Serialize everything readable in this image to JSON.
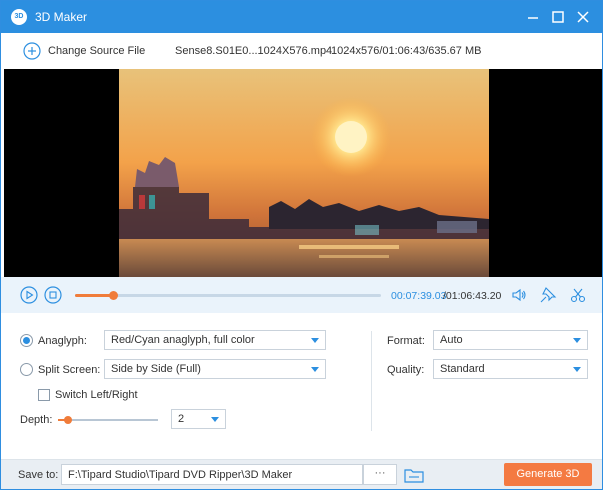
{
  "window": {
    "title": "3D Maker",
    "icon_text": "3D"
  },
  "toolbar": {
    "change_source_label": "Change Source File",
    "file_name": "Sense8.S01E0...1024X576.mp4",
    "file_info": "1024x576/01:06:43/635.67 MB"
  },
  "playback": {
    "current_time": "00:07:39.03",
    "total_time": "/01:06:43.20",
    "progress_fraction": 0.125
  },
  "settings": {
    "anaglyph_label": "Anaglyph:",
    "anaglyph_value": "Red/Cyan anaglyph, full color",
    "anaglyph_selected": true,
    "split_label": "Split Screen:",
    "split_value": "Side by Side (Full)",
    "split_selected": false,
    "switch_label": "Switch Left/Right",
    "switch_checked": false,
    "depth_label": "Depth:",
    "depth_value": "2",
    "depth_fraction": 0.1,
    "format_label": "Format:",
    "format_value": "Auto",
    "quality_label": "Quality:",
    "quality_value": "Standard"
  },
  "bottom": {
    "save_to_label": "Save to:",
    "save_path": "F:\\Tipard Studio\\Tipard DVD Ripper\\3D Maker",
    "browse_label": "···",
    "generate_label": "Generate 3D"
  },
  "colors": {
    "accent": "#2c8fe0",
    "orange": "#f47a42"
  }
}
